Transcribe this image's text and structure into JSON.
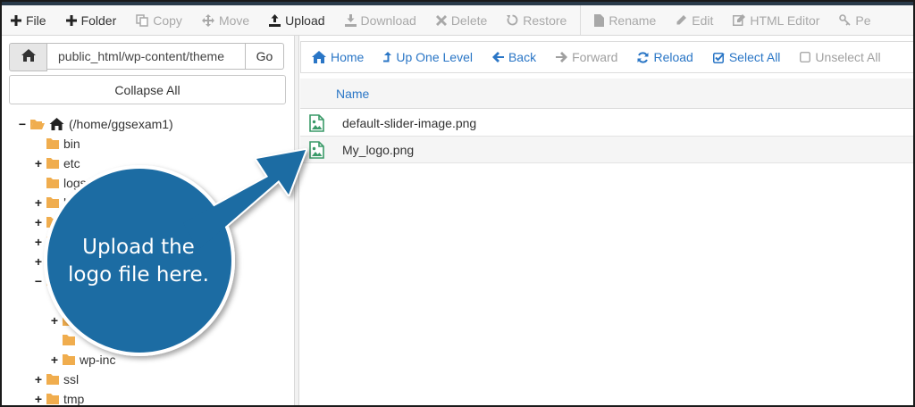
{
  "toolbar": {
    "items": [
      {
        "label": "File",
        "icon": "plus-icon",
        "enabled": true
      },
      {
        "label": "Folder",
        "icon": "plus-icon",
        "enabled": true
      },
      {
        "label": "Copy",
        "icon": "copy-icon",
        "enabled": false
      },
      {
        "label": "Move",
        "icon": "move-icon",
        "enabled": false
      },
      {
        "label": "Upload",
        "icon": "upload-icon",
        "enabled": true
      },
      {
        "label": "Download",
        "icon": "download-icon",
        "enabled": false
      },
      {
        "label": "Delete",
        "icon": "times-icon",
        "enabled": false
      },
      {
        "label": "Restore",
        "icon": "undo-icon",
        "enabled": false
      },
      {
        "label": "Rename",
        "icon": "file-icon",
        "enabled": false
      },
      {
        "label": "Edit",
        "icon": "pencil-icon",
        "enabled": false
      },
      {
        "label": "HTML Editor",
        "icon": "edit-icon",
        "enabled": false
      },
      {
        "label": "Pe",
        "icon": "key-icon",
        "enabled": false
      }
    ]
  },
  "path_bar": {
    "value": "public_html/wp-content/theme",
    "go_label": "Go"
  },
  "collapse_label": "Collapse All",
  "tree": [
    {
      "label": "(/home/ggsexam1)",
      "toggle": "−",
      "icon": "home",
      "indent": 0
    },
    {
      "label": "bin",
      "toggle": "",
      "indent": 1
    },
    {
      "label": "etc",
      "toggle": "+",
      "indent": 1
    },
    {
      "label": "logs",
      "toggle": "",
      "indent": 1
    },
    {
      "label": "ls",
      "toggle": "+",
      "indent": 1
    },
    {
      "label": "",
      "toggle": "+",
      "indent": 1
    },
    {
      "label": "",
      "toggle": "+",
      "indent": 1
    },
    {
      "label": "",
      "toggle": "+",
      "indent": 1
    },
    {
      "label": "",
      "toggle": "−",
      "indent": 1
    },
    {
      "label": "",
      "toggle": "",
      "indent": 2
    },
    {
      "label": "",
      "toggle": "+",
      "indent": 2
    },
    {
      "label": "",
      "toggle": "",
      "indent": 2
    },
    {
      "label": "wp-inc",
      "toggle": "+",
      "indent": 2
    },
    {
      "label": "ssl",
      "toggle": "+",
      "indent": 1
    },
    {
      "label": "tmp",
      "toggle": "+",
      "indent": 1
    }
  ],
  "navbar": {
    "items": [
      {
        "label": "Home",
        "icon": "home-icon",
        "enabled": true
      },
      {
        "label": "Up One Level",
        "icon": "level-up-icon",
        "enabled": true
      },
      {
        "label": "Back",
        "icon": "arrow-left-icon",
        "enabled": true
      },
      {
        "label": "Forward",
        "icon": "arrow-right-icon",
        "enabled": false
      },
      {
        "label": "Reload",
        "icon": "refresh-icon",
        "enabled": true
      },
      {
        "label": "Select All",
        "icon": "check-square-icon",
        "enabled": true
      },
      {
        "label": "Unselect All",
        "icon": "square-icon",
        "enabled": false
      }
    ]
  },
  "table": {
    "header": "Name",
    "rows": [
      {
        "name": "default-slider-image.png",
        "icon": "image-file-icon"
      },
      {
        "name": "My_logo.png",
        "icon": "image-file-icon"
      }
    ]
  },
  "callout": {
    "line1": "Upload the",
    "line2": "logo file here.",
    "color": "#1e6ca3"
  },
  "colors": {
    "link": "#2a76c6",
    "folder": "#f0ad4e",
    "disabled": "#a8a8a8"
  }
}
